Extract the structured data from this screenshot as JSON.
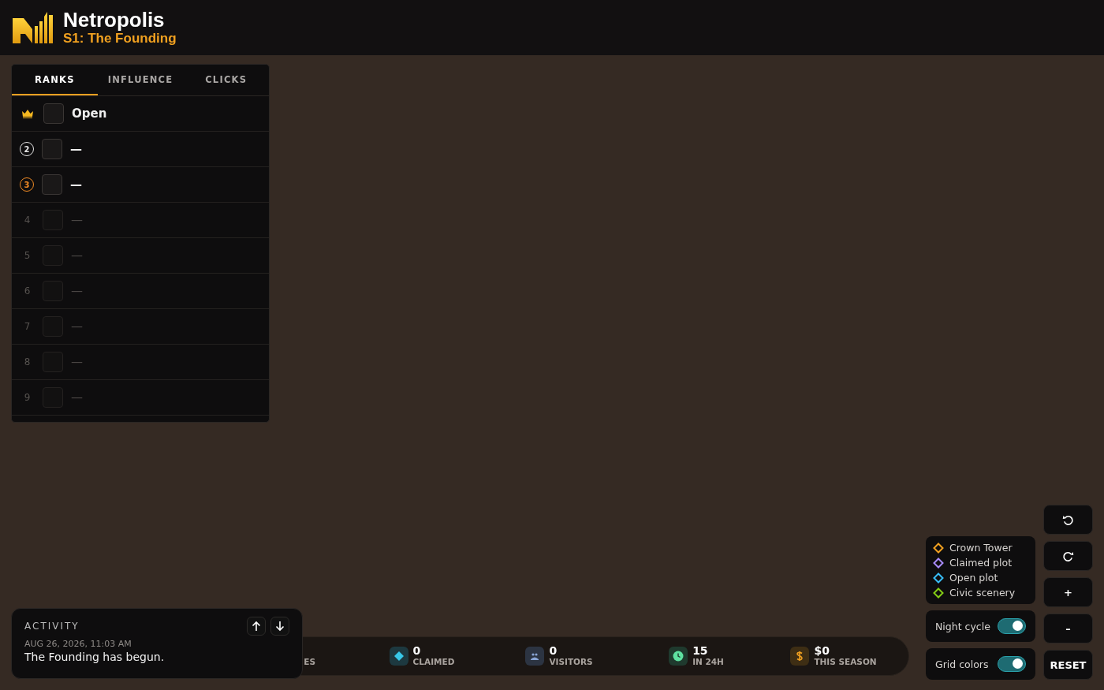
{
  "header": {
    "title": "Netropolis",
    "subtitle": "S1: The Founding"
  },
  "tabs": [
    {
      "label": "RANKS",
      "selected": true
    },
    {
      "label": "INFLUENCE",
      "selected": false
    },
    {
      "label": "CLICKS",
      "selected": false
    }
  ],
  "ranks": [
    {
      "kind": "crown",
      "name": "Open",
      "dimmed": false
    },
    {
      "kind": "ring",
      "label": "2",
      "color": "#e6e6e6",
      "name": "—",
      "dimmed": false
    },
    {
      "kind": "ring",
      "label": "3",
      "color": "#f08a24",
      "name": "—",
      "dimmed": false
    },
    {
      "kind": "plain",
      "label": "4",
      "name": "—",
      "dimmed": true
    },
    {
      "kind": "plain",
      "label": "5",
      "name": "—",
      "dimmed": true
    },
    {
      "kind": "plain",
      "label": "6",
      "name": "—",
      "dimmed": true
    },
    {
      "kind": "plain",
      "label": "7",
      "name": "—",
      "dimmed": true
    },
    {
      "kind": "plain",
      "label": "8",
      "name": "—",
      "dimmed": true
    },
    {
      "kind": "plain",
      "label": "9",
      "name": "—",
      "dimmed": true
    }
  ],
  "activity": {
    "title": "ACTIVITY",
    "timestamp": "AUG 26, 2026, 11:03 AM",
    "message": "The Founding has begun."
  },
  "stats": [
    {
      "kind": "clipped",
      "label": "ES"
    },
    {
      "kind": "claimed",
      "value": "0",
      "label": "CLAIMED"
    },
    {
      "kind": "visitors",
      "value": "0",
      "label": "VISITORS"
    },
    {
      "kind": "clock",
      "value": "15",
      "label": "IN 24H"
    },
    {
      "kind": "money",
      "value": "$0",
      "label": "THIS SEASON"
    }
  ],
  "legend": [
    {
      "label": "Crown Tower",
      "color": "#f0a020"
    },
    {
      "label": "Claimed plot",
      "color": "#a78bfa"
    },
    {
      "label": "Open plot",
      "color": "#38bdf8"
    },
    {
      "label": "Civic scenery",
      "color": "#84cc16"
    }
  ],
  "toggles": [
    {
      "label": "Night cycle",
      "on": true
    },
    {
      "label": "Grid colors",
      "on": true
    }
  ],
  "controls": [
    {
      "kind": "rotate-left"
    },
    {
      "kind": "rotate-right"
    },
    {
      "kind": "text",
      "label": "+"
    },
    {
      "kind": "text",
      "label": "–"
    },
    {
      "kind": "text",
      "label": "RESET"
    }
  ]
}
